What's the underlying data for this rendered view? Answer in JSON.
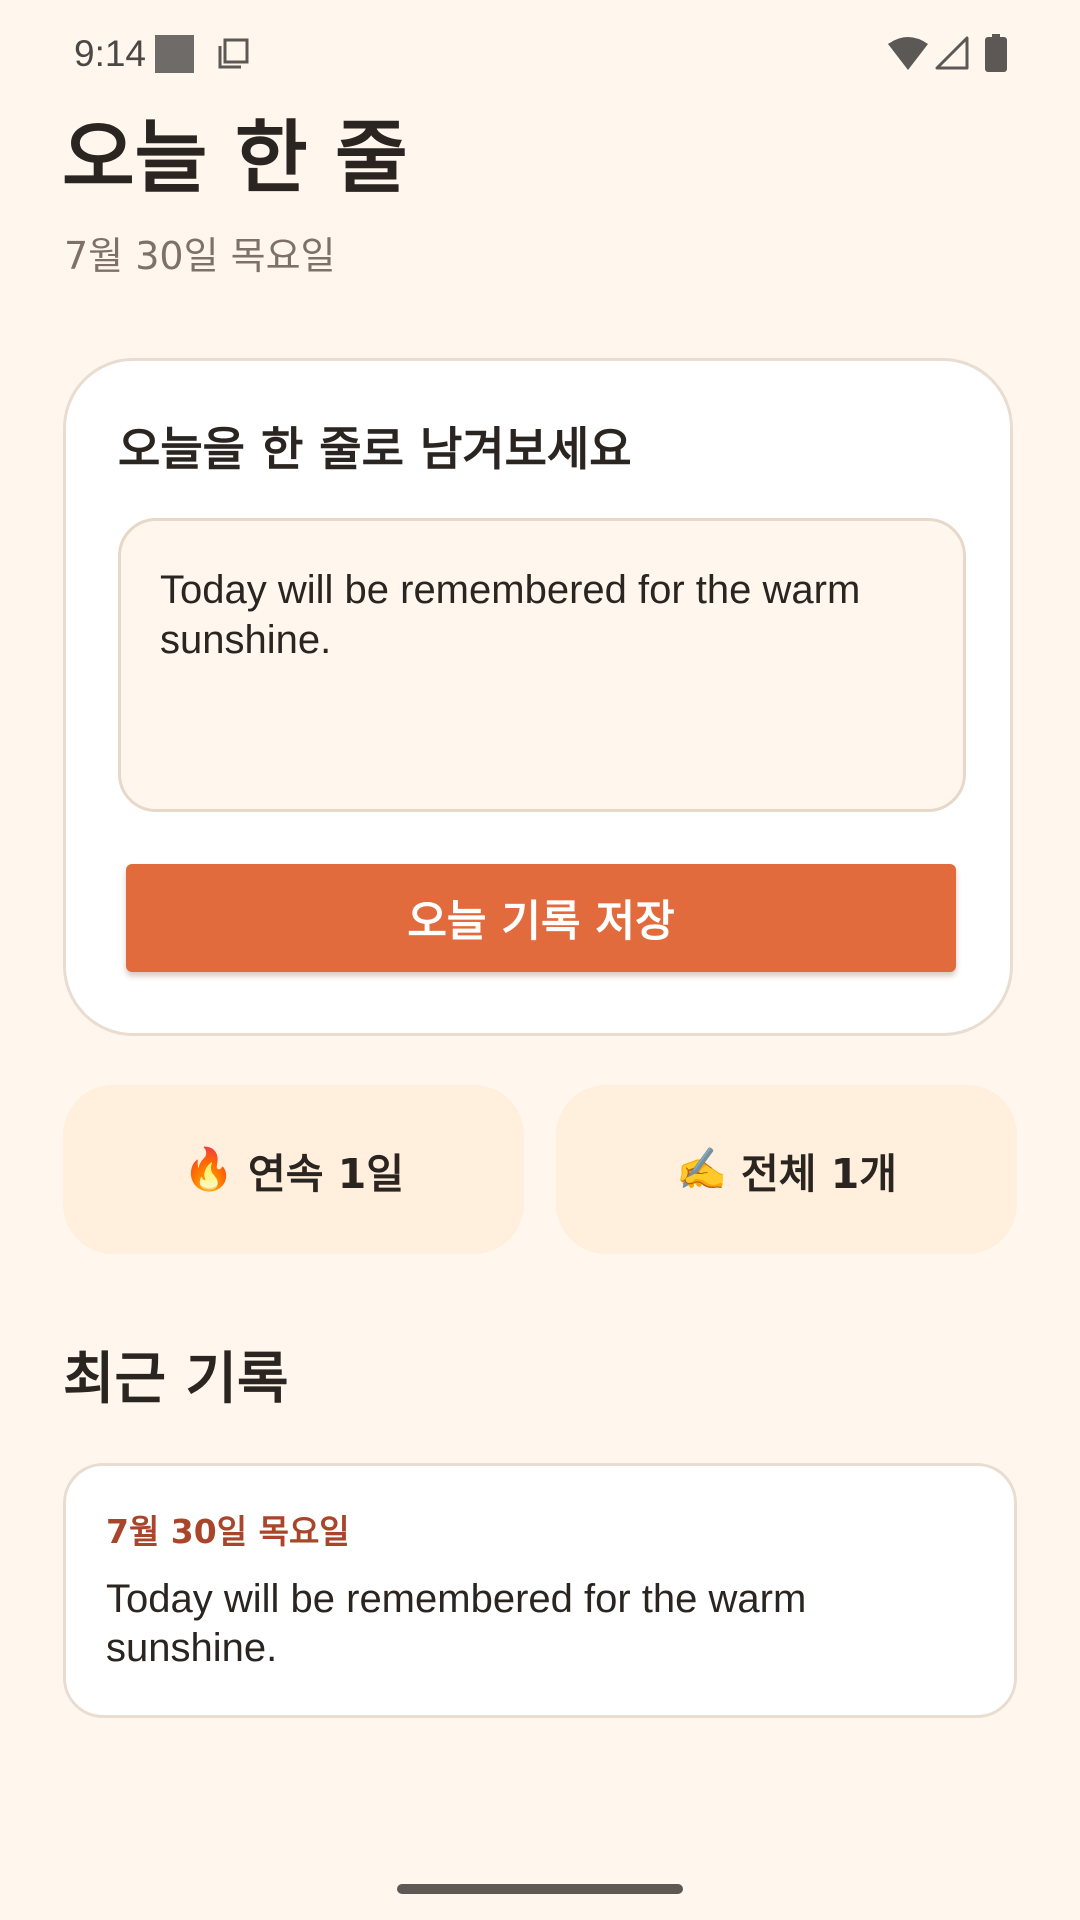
{
  "status_bar": {
    "time": "9:14",
    "icons": [
      "notification-square-icon",
      "screenshot-icon",
      "wifi-icon",
      "cell-signal-icon",
      "battery-icon"
    ]
  },
  "header": {
    "title": "오늘 한 줄",
    "date": "7월 30일 목요일"
  },
  "entry": {
    "prompt": "오늘을 한 줄로 남겨보세요",
    "text_value": "Today will be remembered for the warm sunshine.",
    "save_label": "오늘 기록 저장"
  },
  "stats": {
    "streak_icon": "🔥",
    "streak_label": "연속 1일",
    "total_icon": "✍️",
    "total_label": "전체 1개"
  },
  "recent": {
    "heading": "최근 기록",
    "items": [
      {
        "date": "7월 30일 목요일",
        "text": "Today will be remembered for the warm sunshine."
      }
    ]
  },
  "colors": {
    "background": "#FFF7EE",
    "accent": "#E26B3E",
    "record_date": "#A9452A",
    "stat_card": "#FFEFDC"
  }
}
